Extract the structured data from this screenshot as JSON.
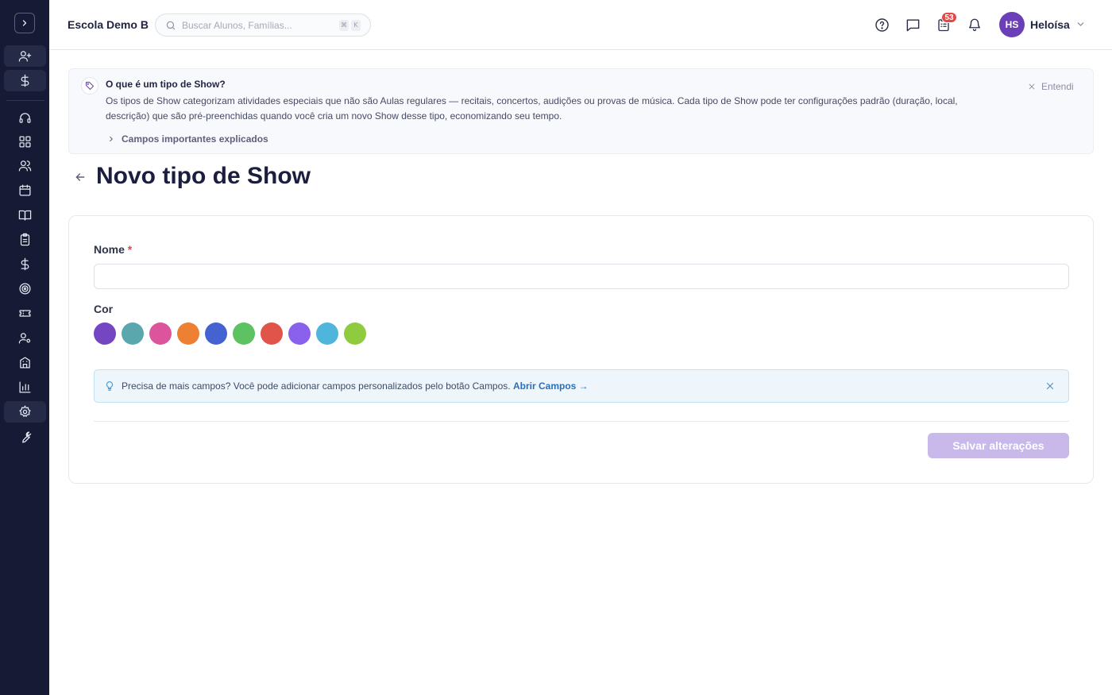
{
  "header": {
    "school_name": "Escola Demo B",
    "search_placeholder": "Buscar Alunos, Famílias...",
    "shortcut_keys": [
      "⌘",
      "K"
    ],
    "notification_count": "53",
    "user_initials": "HS",
    "user_name": "Heloísa"
  },
  "sidebar": {
    "items": [
      {
        "icon": "user-plus-icon"
      },
      {
        "icon": "dollar-icon"
      },
      {
        "icon": "headset-icon"
      },
      {
        "icon": "dashboard-icon"
      },
      {
        "icon": "users-icon"
      },
      {
        "icon": "calendar-icon"
      },
      {
        "icon": "book-icon"
      },
      {
        "icon": "clipboard-icon"
      },
      {
        "icon": "dollar-icon"
      },
      {
        "icon": "target-icon"
      },
      {
        "icon": "ticket-icon"
      },
      {
        "icon": "user-settings-icon"
      },
      {
        "icon": "building-icon"
      },
      {
        "icon": "bar-chart-icon"
      },
      {
        "icon": "gear-icon"
      },
      {
        "icon": "wrench-icon"
      }
    ]
  },
  "info_banner": {
    "title": "O que é um tipo de Show?",
    "text": "Os tipos de Show categorizam atividades especiais que não são Aulas regulares — recitais, concertos, audições ou provas de música. Cada tipo de Show pode ter configurações padrão (duração, local, descrição) que são pré-preenchidas quando você cria um novo Show desse tipo, economizando seu tempo.",
    "more_label": "Campos importantes explicados",
    "dismiss_label": "Entendi"
  },
  "page": {
    "title": "Novo tipo de Show"
  },
  "form": {
    "name_label": "Nome",
    "required_mark": "*",
    "name_value": "",
    "color_label": "Cor",
    "colors": [
      "#7446c2",
      "#5aa7ae",
      "#dc559c",
      "#ed8033",
      "#4563d0",
      "#5cc262",
      "#e05449",
      "#8961ec",
      "#4fb5da",
      "#8ecb3e"
    ],
    "tip_text": "Precisa de mais campos? Você pode adicionar campos personalizados pelo botão Campos.",
    "tip_link": "Abrir Campos →",
    "save_label": "Salvar alterações"
  }
}
